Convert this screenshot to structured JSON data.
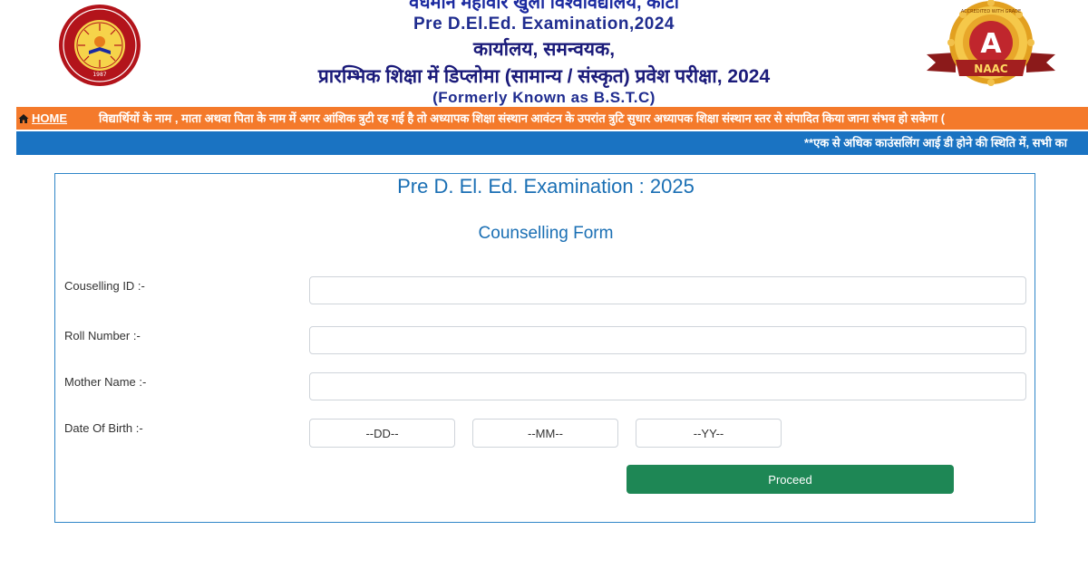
{
  "header": {
    "university": "वर्धमान महावीर खुला विश्वविद्यालय, कोटा",
    "exam_title": "Pre D.El.Ed. Examination,2024",
    "office": "कार्यालय, समन्वयक,",
    "diploma": "प्रारम्भिक शिक्षा में डिप्लोमा (सामान्य / संस्कृत) प्रवेश परीक्षा, 2024",
    "formerly": "(Formerly Known as B.S.T.C)",
    "logo_left": {
      "icon": "university-seal-logo",
      "established": "1987"
    },
    "logo_right": {
      "icon": "naac-badge-logo",
      "ring_text": "ACCREDITED WITH GRADE",
      "grade": "A",
      "ribbon": "NAAC"
    }
  },
  "nav": {
    "home_label": "HOME",
    "home_icon": "home-icon",
    "marquee_text": "विद्यार्थियों के नाम , माता अथवा पिता के नाम में अगर आंशिक त्रुटी रह गई है तो अध्यापक शिक्षा संस्थान आवंटन के उपरांत त्रुटि सुधार अध्यापक शिक्षा संस्थान स्तर से संपादित किया जाना संभव हो सकेगा (",
    "notice_text": "**एक से अधिक काउंसलिंग आई डी होने की स्थिति में, सभी का"
  },
  "form": {
    "title": "Pre D. El. Ed. Examination : 2025",
    "subtitle": "Counselling Form",
    "fields": {
      "counselling_id": {
        "label": "Couselling ID :-",
        "value": ""
      },
      "roll_number": {
        "label": "Roll Number :-",
        "value": ""
      },
      "mother_name": {
        "label": "Mother Name :-",
        "value": ""
      },
      "dob": {
        "label": "Date Of Birth :-",
        "day": "--DD--",
        "month": "--MM--",
        "year": "--YY--"
      }
    },
    "proceed_label": "Proceed"
  },
  "colors": {
    "orange_bar": "#f47a2b",
    "blue_bar": "#1a73c2",
    "form_title": "#1a6fb4",
    "proceed": "#1e8755",
    "header_text": "#1b2aa0"
  }
}
